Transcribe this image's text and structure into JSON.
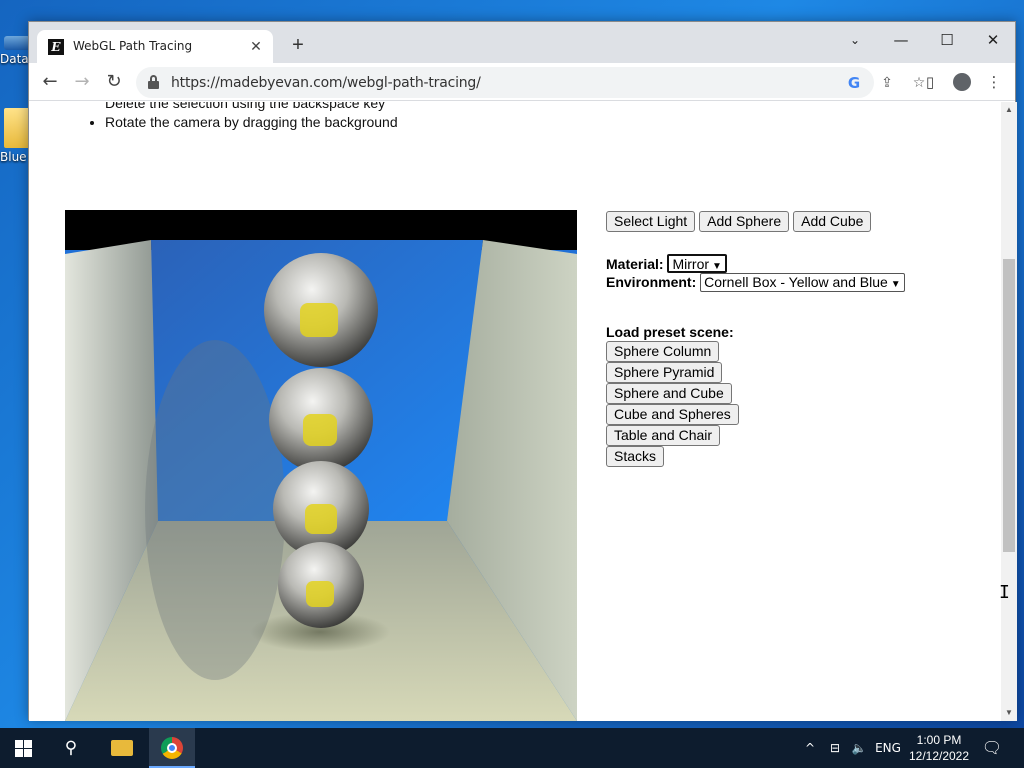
{
  "desktop": {
    "icons": [
      {
        "label": "Data"
      },
      {
        "label": "Blue"
      }
    ]
  },
  "browser": {
    "tab": {
      "title": "WebGL Path Tracing",
      "favicon": "E"
    },
    "url": "https://madebyevan.com/webgl-path-tracing/",
    "icons": {
      "back": "←",
      "forward": "→",
      "reload": "↻",
      "new_tab": "+",
      "tab_close": "✕",
      "tab_search": "⌄",
      "minimize": "—",
      "maximize": "☐",
      "close": "✕",
      "google": "G",
      "share": "⇪",
      "star": "☆",
      "side_panel": "▯",
      "menu": "⋮"
    }
  },
  "page": {
    "instructions": [
      "Delete the selection using the backspace key",
      "Rotate the camera by dragging the background"
    ],
    "buttons": {
      "select_light": "Select Light",
      "add_sphere": "Add Sphere",
      "add_cube": "Add Cube"
    },
    "material": {
      "label": "Material:",
      "value": "Mirror"
    },
    "environment": {
      "label": "Environment:",
      "value": "Cornell Box - Yellow and Blue"
    },
    "presets": {
      "title": "Load preset scene:",
      "items": [
        "Sphere Column",
        "Sphere Pyramid",
        "Sphere and Cube",
        "Cube and Spheres",
        "Table and Chair",
        "Stacks"
      ]
    },
    "render": {
      "wall_colors": {
        "back": "#1f6fd6",
        "left": "#c7cfc6",
        "right": "#c4cbb8",
        "floor": "#c6c9ad",
        "sphere": "#c0c0c0",
        "reflection": "#e3d21e"
      }
    }
  },
  "taskbar": {
    "tray": {
      "chevron": "^",
      "network": "⊟",
      "volume": "🔈",
      "language": "ENG"
    },
    "clock": {
      "time": "1:00 PM",
      "date": "12/12/2022"
    },
    "notifications": "🗨"
  }
}
